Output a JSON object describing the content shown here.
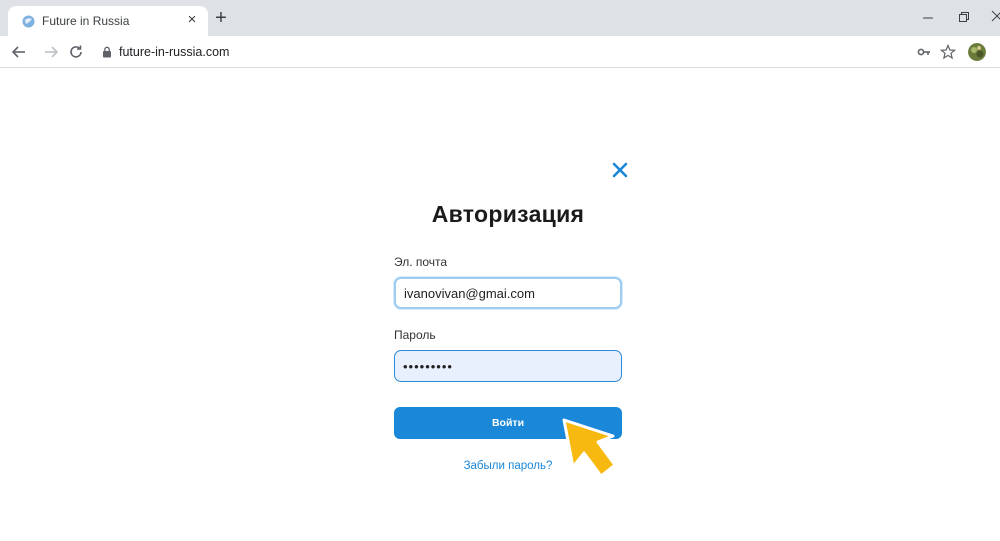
{
  "browser": {
    "tab_title": "Future in Russia",
    "tab_close_glyph": "×",
    "new_tab_glyph": "+",
    "url": "future-in-russia.com",
    "icons": [
      "favicon",
      "back-arrow-icon",
      "forward-arrow-icon",
      "reload-icon",
      "lock-icon",
      "key-icon",
      "star-icon",
      "avatar"
    ]
  },
  "login": {
    "title": "Авторизация",
    "email_label": "Эл. почта",
    "email_value": "ivanovivan@gmai.com",
    "password_label": "Пароль",
    "password_value": "•••••••••",
    "submit_label": "Войти",
    "forgot_label": "Забыли пароль?"
  },
  "colors": {
    "accent": "#1b87d8",
    "pointer": "#f7b90f",
    "title": "#1b1b1b"
  }
}
